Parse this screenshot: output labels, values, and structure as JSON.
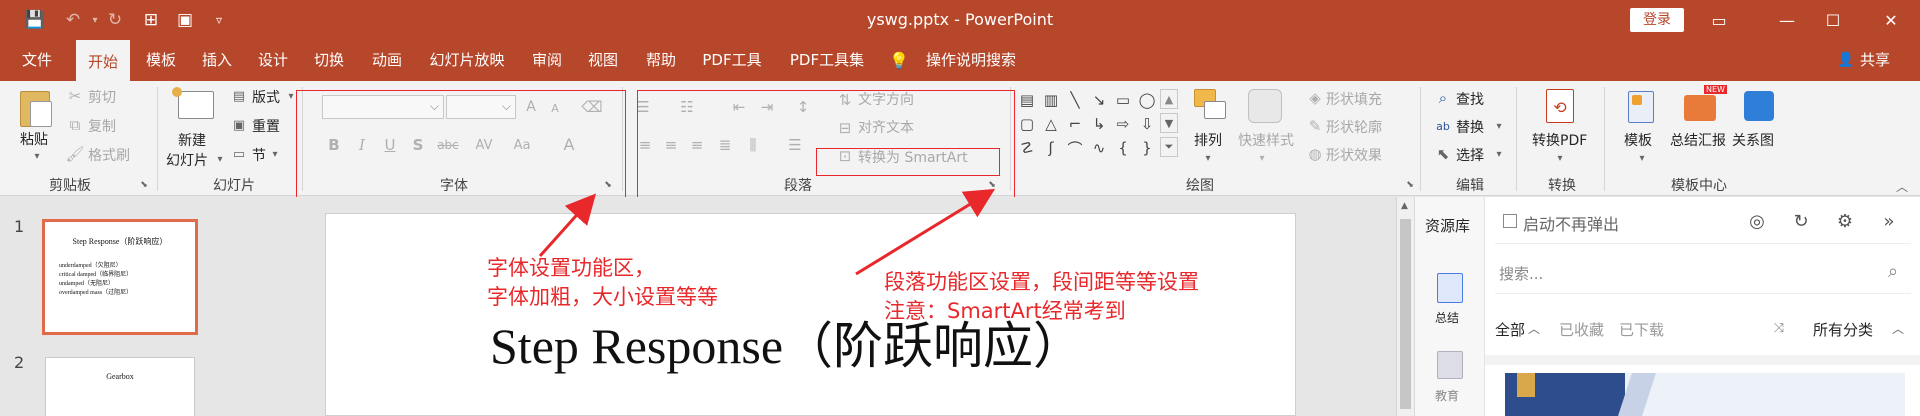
{
  "window": {
    "title": "yswg.pptx  -  PowerPoint",
    "login_label": "登录",
    "controls": {
      "minimize": "—",
      "maximize": "☐",
      "close": "✕",
      "ribbon_display": "▭"
    }
  },
  "quick_access": {
    "save_icon": "💾",
    "undo_icon": "↶",
    "undo_arrow": "▾",
    "redo_icon": "↻",
    "start_icon": "⊞",
    "layout_icon": "▣",
    "customize_icon": "▿"
  },
  "menu": {
    "tabs": [
      "文件",
      "开始",
      "模板",
      "插入",
      "设计",
      "切换",
      "动画",
      "幻灯片放映",
      "审阅",
      "视图",
      "帮助",
      "PDF工具",
      "PDF工具集",
      "操作说明搜索"
    ],
    "active_tab": "开始",
    "share_label": "共享",
    "tellme_icon": "💡",
    "share_icon": "👤"
  },
  "ribbon": {
    "clipboard": {
      "label": "剪贴板",
      "paste": "粘贴",
      "cut": "剪切",
      "copy": "复制",
      "format_painter": "格式刷"
    },
    "slides": {
      "label": "幻灯片",
      "new_slide": "新建",
      "new_slide2": "幻灯片",
      "layout": "版式",
      "reset": "重置",
      "section": "节"
    },
    "font": {
      "label": "字体",
      "bold": "B",
      "italic": "I",
      "underline": "U",
      "shadow": "S",
      "strike": "abc",
      "spacing": "AV",
      "case": "Aa",
      "color": "A",
      "grow": "A",
      "shrink": "A"
    },
    "paragraph": {
      "label": "段落",
      "text_direction": "文字方向",
      "align_text": "对齐文本",
      "smartart": "转换为 SmartArt"
    },
    "drawing": {
      "label": "绘图",
      "arrange": "排列",
      "quick_styles": "快速样式",
      "fill": "形状填充",
      "outline": "形状轮廓",
      "effects": "形状效果"
    },
    "editing": {
      "label": "编辑",
      "find": "查找",
      "replace": "替换",
      "select": "选择"
    },
    "convert": {
      "label": "转换",
      "to_pdf": "转换PDF"
    },
    "template_center": {
      "label": "模板中心",
      "template": "模板",
      "summary": "总结汇报",
      "relation": "关系图",
      "new_badge": "NEW"
    }
  },
  "slides_pane": {
    "items": [
      {
        "number": "1",
        "title": "Step Response（阶跃响应）",
        "bullets": [
          "underdamped（欠阻尼）",
          "critical damped（临界阻尼）",
          "undamped（无阻尼）",
          "overdamped mass（过阻尼）"
        ]
      },
      {
        "number": "2",
        "title": "Gearbox"
      }
    ]
  },
  "slide": {
    "title": "Step Response（阶跃响应）"
  },
  "annotations": {
    "font_note_line1": "字体设置功能区，",
    "font_note_line2": "字体加粗，大小设置等等",
    "para_note_line1": "段落功能区设置，段间距等等设置",
    "para_note_line2": "注意：SmartArt经常考到"
  },
  "resource_panel": {
    "tab_label": "资源库",
    "no_popup_label": "启动不再弹出",
    "search_placeholder": "搜索...",
    "filters": {
      "all": "全部",
      "favorites": "已收藏",
      "downloaded": "已下载",
      "categories": "所有分类"
    },
    "side": {
      "summary": "总结",
      "education": "教育"
    }
  }
}
